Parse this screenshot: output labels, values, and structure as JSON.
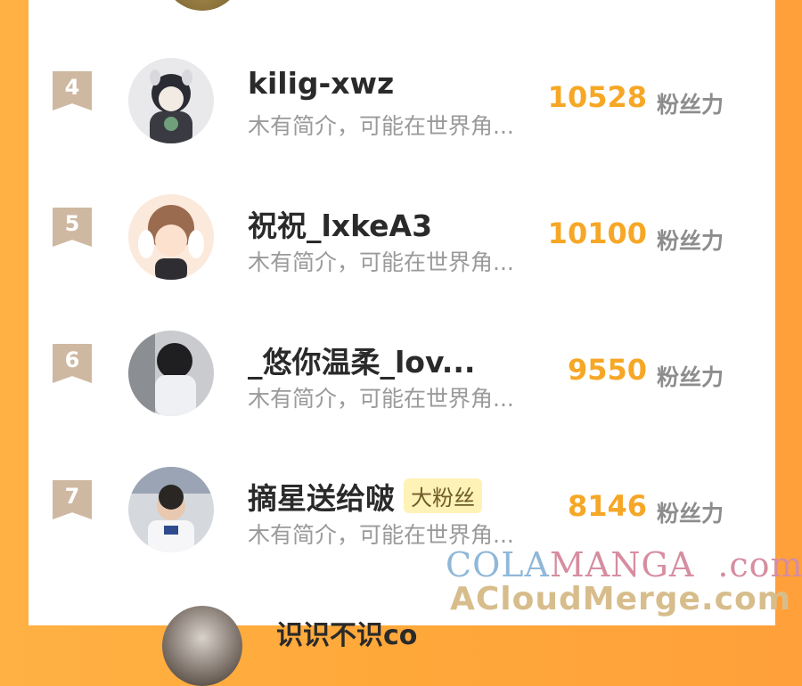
{
  "unit_label": "粉丝力",
  "rows": [
    {
      "rank": "4",
      "name": "kilig-xwz",
      "badge": "",
      "desc": "木有简介，可能在世界角...",
      "score": "10528"
    },
    {
      "rank": "5",
      "name": "祝祝_lxkeA3",
      "badge": "",
      "desc": "木有简介，可能在世界角...",
      "score": "10100"
    },
    {
      "rank": "6",
      "name": "_悠你温柔_lov...",
      "badge": "",
      "desc": "木有简介，可能在世界角...",
      "score": "9550"
    },
    {
      "rank": "7",
      "name": "摘星送给啵",
      "badge": "大粉丝",
      "desc": "木有简介，可能在世界角...",
      "score": "8146"
    }
  ],
  "next_row_name": "识识不识co",
  "watermark": {
    "line1_a": "COLA",
    "line1_b": "MANGA",
    "line1_c": ".com",
    "line2": "ACloudMerge.com"
  },
  "colors": {
    "score": "#f6a726",
    "rank_badge": "#cfb8a1",
    "background": "#ffa83a"
  }
}
